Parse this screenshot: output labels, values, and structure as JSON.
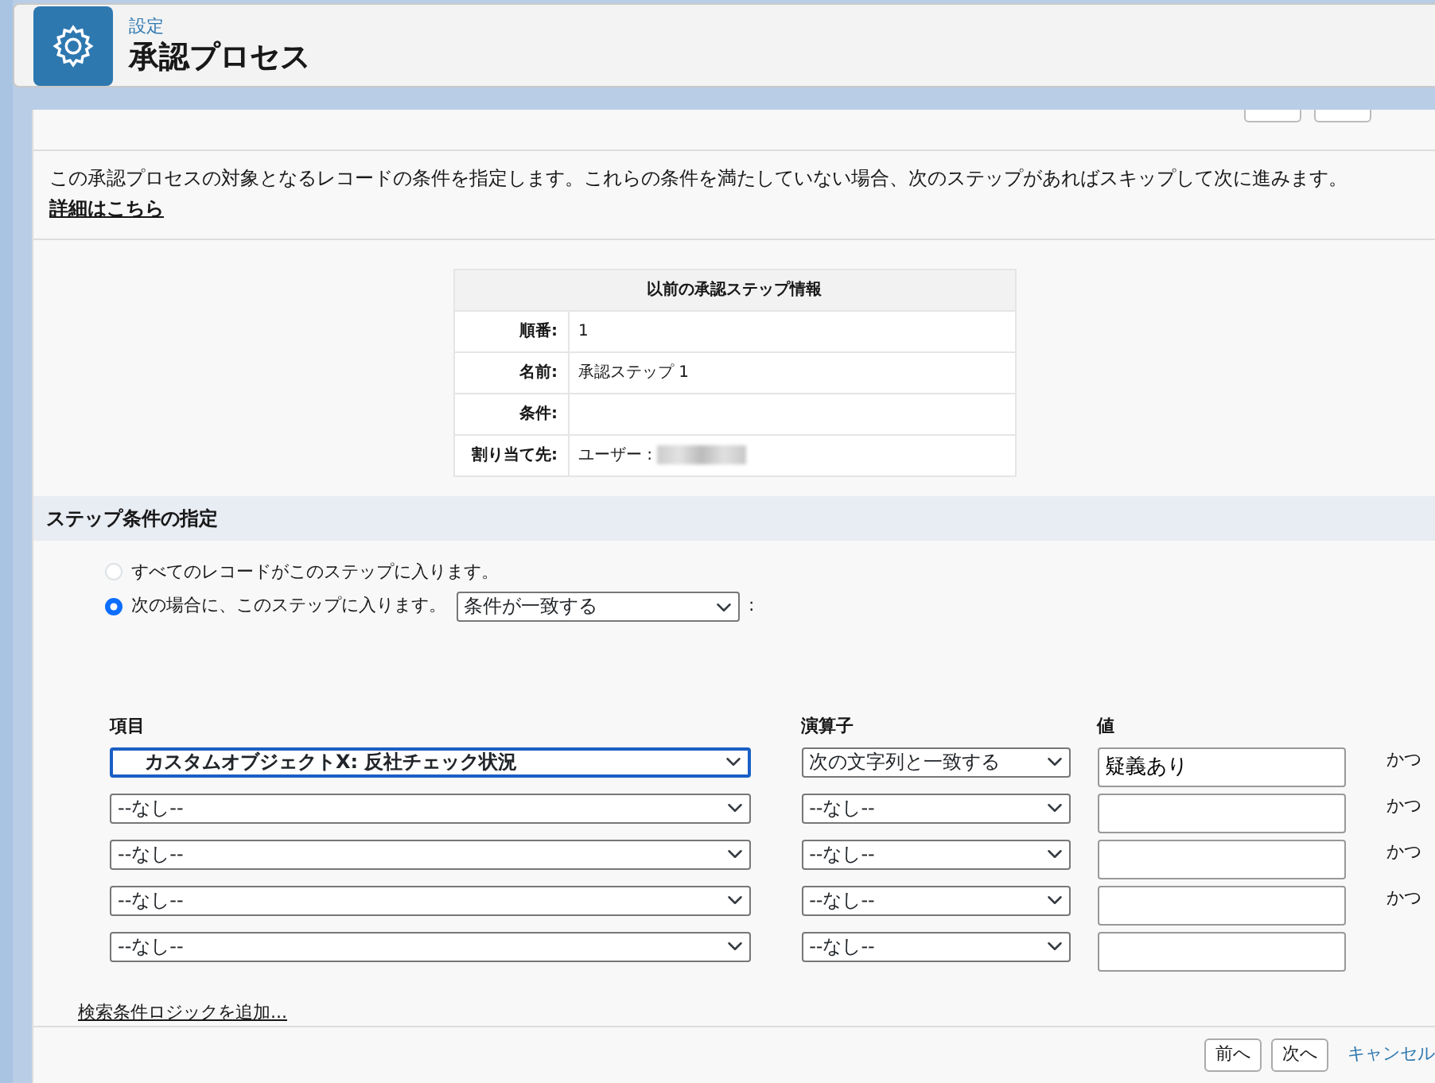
{
  "header": {
    "breadcrumb": "設定",
    "title": "承認プロセス"
  },
  "description": {
    "text": "この承認プロセスの対象となるレコードの条件を指定します。これらの条件を満たしていない場合、次のステップがあればスキップして次に進みます。",
    "link": "詳細はこちら"
  },
  "previous_step": {
    "title": "以前の承認ステップ情報",
    "rows": [
      {
        "label": "順番:",
        "value": "1"
      },
      {
        "label": "名前:",
        "value": "承認ステップ 1"
      },
      {
        "label": "条件:",
        "value": ""
      },
      {
        "label": "割り当て先:",
        "value": "ユーザー :",
        "redacted": true
      }
    ]
  },
  "section": {
    "title": "ステップ条件の指定"
  },
  "entry_options": [
    {
      "label": "すべてのレコードがこのステップに入ります。",
      "selected": false
    },
    {
      "label": "次の場合に、このステップに入ります。",
      "selected": true,
      "select": "条件が一致する",
      "suffix": ":"
    }
  ],
  "criteria": {
    "columns": [
      "項目",
      "演算子",
      "値"
    ],
    "rows": [
      {
        "field": "カスタムオブジェクトX: 反社チェック状況",
        "operator": "次の文字列と一致する",
        "value": "疑義あり",
        "conjunction": "かつ",
        "focused": true
      },
      {
        "field": "--なし--",
        "operator": "--なし--",
        "value": "",
        "conjunction": "かつ",
        "focused": false
      },
      {
        "field": "--なし--",
        "operator": "--なし--",
        "value": "",
        "conjunction": "かつ",
        "focused": false
      },
      {
        "field": "--なし--",
        "operator": "--なし--",
        "value": "",
        "conjunction": "かつ",
        "focused": false
      },
      {
        "field": "--なし--",
        "operator": "--なし--",
        "value": "",
        "focused": false
      }
    ]
  },
  "logic_link": "検索条件ロジックを追加...",
  "footer_buttons": [
    {
      "label": "前へ",
      "kind": "button"
    },
    {
      "label": "次へ",
      "kind": "button"
    },
    {
      "label": "キャンセル",
      "kind": "link"
    }
  ]
}
